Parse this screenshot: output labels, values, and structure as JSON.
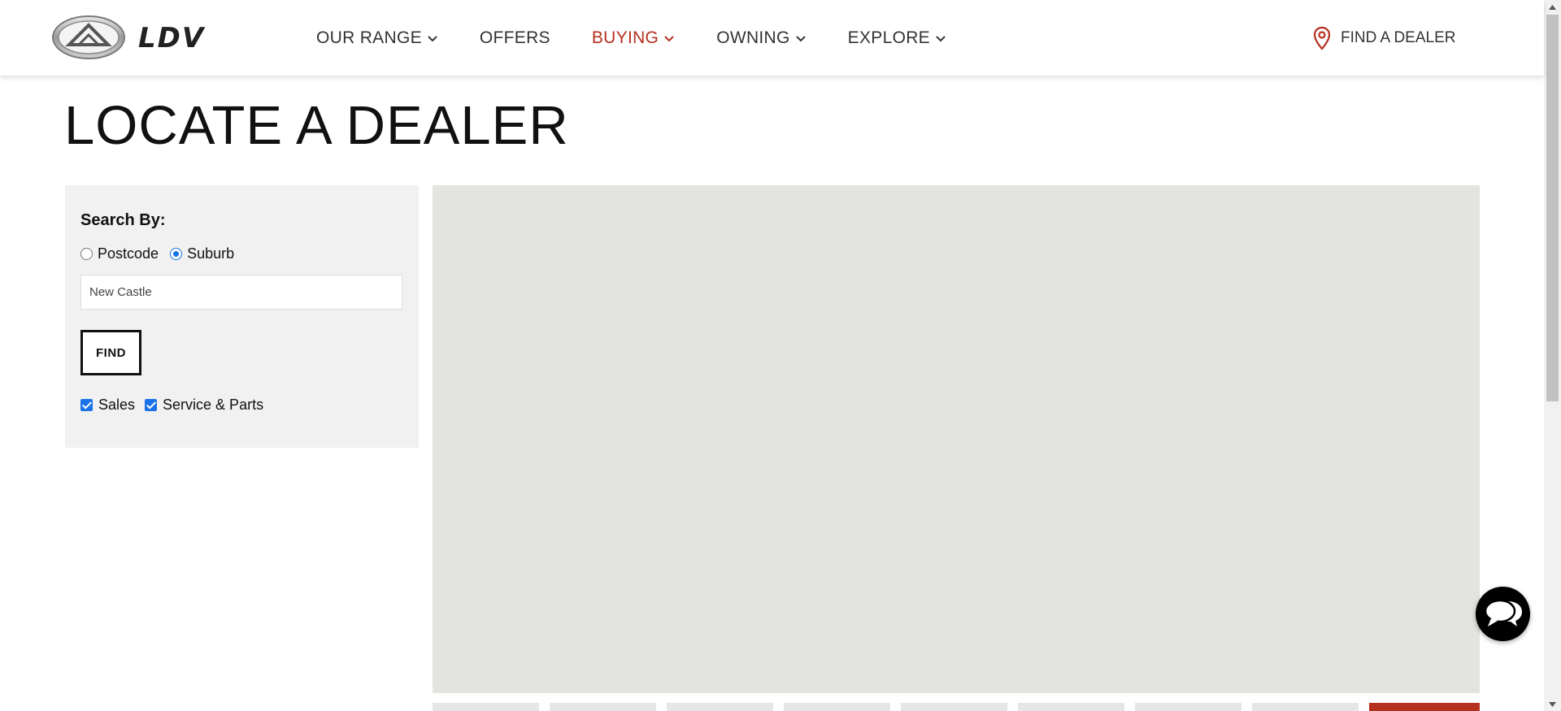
{
  "brand": {
    "logo_text": "LDV",
    "accent_color": "#b5301f",
    "logo_icon": "ldv-emblem-icon"
  },
  "nav": {
    "items": [
      {
        "label": "OUR RANGE",
        "has_dropdown": true,
        "active": false
      },
      {
        "label": "OFFERS",
        "has_dropdown": false,
        "active": false
      },
      {
        "label": "BUYING",
        "has_dropdown": true,
        "active": true
      },
      {
        "label": "OWNING",
        "has_dropdown": true,
        "active": false
      },
      {
        "label": "EXPLORE",
        "has_dropdown": true,
        "active": false
      }
    ],
    "find_dealer_label": "FIND A DEALER",
    "find_dealer_icon": "map-pin-icon"
  },
  "page": {
    "title": "LOCATE A DEALER"
  },
  "search": {
    "heading": "Search By:",
    "options": [
      {
        "label": "Postcode",
        "selected": false
      },
      {
        "label": "Suburb",
        "selected": true
      }
    ],
    "input_value": "New Castle",
    "find_label": "FIND",
    "filters": [
      {
        "label": "Sales",
        "checked": true
      },
      {
        "label": "Service & Parts",
        "checked": true
      }
    ]
  },
  "map": {
    "background_color": "#e3e3df"
  },
  "chat": {
    "icon": "chat-bubbles-icon"
  }
}
